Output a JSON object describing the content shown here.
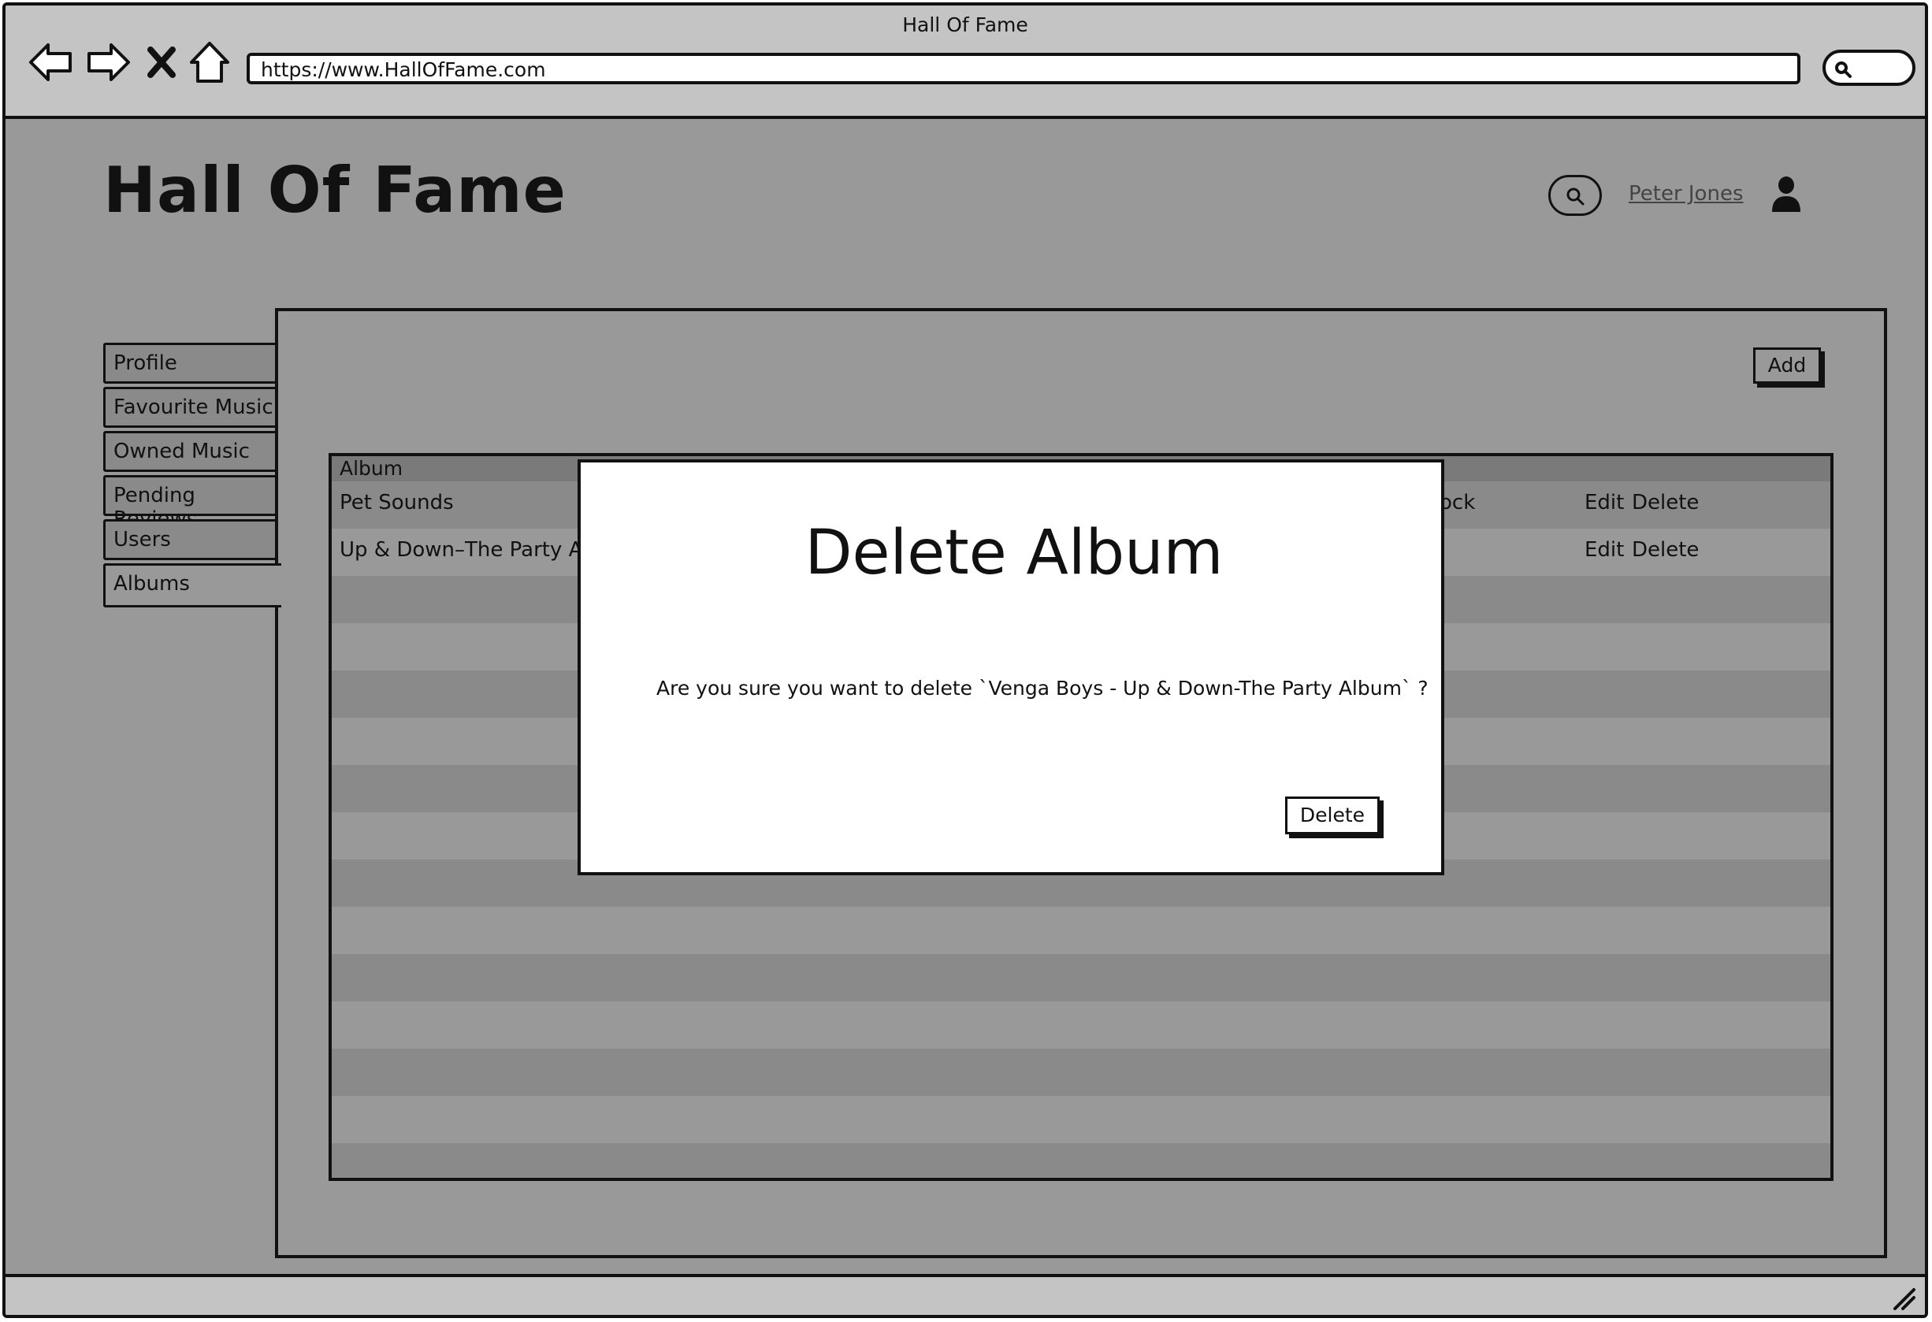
{
  "browser": {
    "window_title": "Hall Of Fame",
    "url": "https://www.HallOfFame.com",
    "icons": [
      "back-arrow-icon",
      "forward-arrow-icon",
      "close-icon",
      "home-icon",
      "search-icon"
    ]
  },
  "header": {
    "site_title": "Hall Of Fame",
    "user_name": "Peter Jones"
  },
  "sidebar": {
    "tabs": [
      {
        "label": "Profile"
      },
      {
        "label": "Favourite Music"
      },
      {
        "label": "Owned Music"
      },
      {
        "label": "Pending Reviews"
      },
      {
        "label": "Users"
      },
      {
        "label": "Albums",
        "active": true
      }
    ]
  },
  "albums": {
    "add_label": "Add",
    "column_header": "Album",
    "rows": [
      {
        "album": "Pet Sounds",
        "partial_cell": "ock",
        "edit": "Edit",
        "delete": "Delete"
      },
      {
        "album": "Up & Down–The Party Alb",
        "partial_cell": "",
        "edit": "Edit",
        "delete": "Delete"
      }
    ]
  },
  "modal": {
    "title": "Delete Album",
    "message": "Are you sure you want to delete `Venga Boys - Up & Down-The Party Album` ?",
    "delete_label": "Delete"
  },
  "colors": {
    "overlay_gray": "#999999",
    "chrome_gray": "#c4c4c4",
    "stripe_gray": "#8a8a8a",
    "ink": "#111111"
  }
}
